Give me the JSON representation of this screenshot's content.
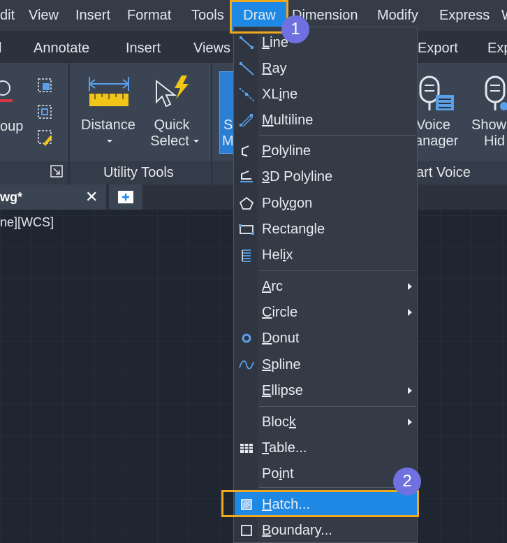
{
  "menubar": {
    "items": [
      "dit",
      "View",
      "Insert",
      "Format",
      "Tools",
      "Draw",
      "Dimension",
      "Modify",
      "Express",
      "W"
    ]
  },
  "ribbon_tabs": [
    "l",
    "Annotate",
    "Insert",
    "Views",
    "Export",
    "Exp"
  ],
  "ribbon": {
    "group_fragment": "oup",
    "distance_label": "Distance",
    "quick_select_line1": "Quick",
    "quick_select_line2": "Select",
    "s_fragment_1": "S",
    "s_fragment_2": "M",
    "voice_line1": "Voice",
    "voice_line2": "anager",
    "show_line1": "Show",
    "show_line2": "Hid",
    "utility_tools": "Utility Tools",
    "smart_voice": "art Voice"
  },
  "document": {
    "tab_name": "wg*",
    "close_glyph": "✕",
    "view_label": "ne][WCS]"
  },
  "draw_menu": {
    "items": [
      {
        "pre": "",
        "u": "L",
        "post": "ine",
        "icon": "line-icon"
      },
      {
        "pre": "",
        "u": "R",
        "post": "ay",
        "icon": "ray-icon"
      },
      {
        "pre": "XL",
        "u": "i",
        "post": "ne",
        "icon": "xline-icon"
      },
      {
        "pre": "",
        "u": "M",
        "post": "ultiline",
        "icon": "multiline-icon"
      },
      {
        "pre": "",
        "u": "P",
        "post": "olyline",
        "icon": "polyline-icon"
      },
      {
        "pre": "",
        "u": "3",
        "post": "D Polyline",
        "icon": "3d-polyline-icon"
      },
      {
        "pre": "Pol",
        "u": "y",
        "post": "gon",
        "icon": "polygon-icon"
      },
      {
        "pre": "Rectan",
        "u": "g",
        "post": "le",
        "icon": "rectangle-icon"
      },
      {
        "pre": "Hel",
        "u": "i",
        "post": "x",
        "icon": "helix-icon"
      },
      {
        "pre": "",
        "u": "A",
        "post": "rc",
        "icon": ""
      },
      {
        "pre": "",
        "u": "C",
        "post": "ircle",
        "icon": ""
      },
      {
        "pre": "",
        "u": "D",
        "post": "onut",
        "icon": "donut-icon"
      },
      {
        "pre": "",
        "u": "S",
        "post": "pline",
        "icon": "spline-icon"
      },
      {
        "pre": "",
        "u": "E",
        "post": "llipse",
        "icon": ""
      },
      {
        "pre": "Bloc",
        "u": "k",
        "post": "",
        "icon": ""
      },
      {
        "pre": "",
        "u": "T",
        "post": "able...",
        "icon": "table-icon"
      },
      {
        "pre": "Po",
        "u": "i",
        "post": "nt",
        "icon": ""
      },
      {
        "pre": "",
        "u": "H",
        "post": "atch...",
        "icon": "hatch-icon"
      },
      {
        "pre": "",
        "u": "B",
        "post": "oundary...",
        "icon": "boundary-icon"
      }
    ]
  },
  "callouts": {
    "step1": "1",
    "step2": "2"
  },
  "colors": {
    "highlight": "#1e88e5",
    "callout_border": "#f0a81c",
    "badge": "#6f71e0"
  }
}
